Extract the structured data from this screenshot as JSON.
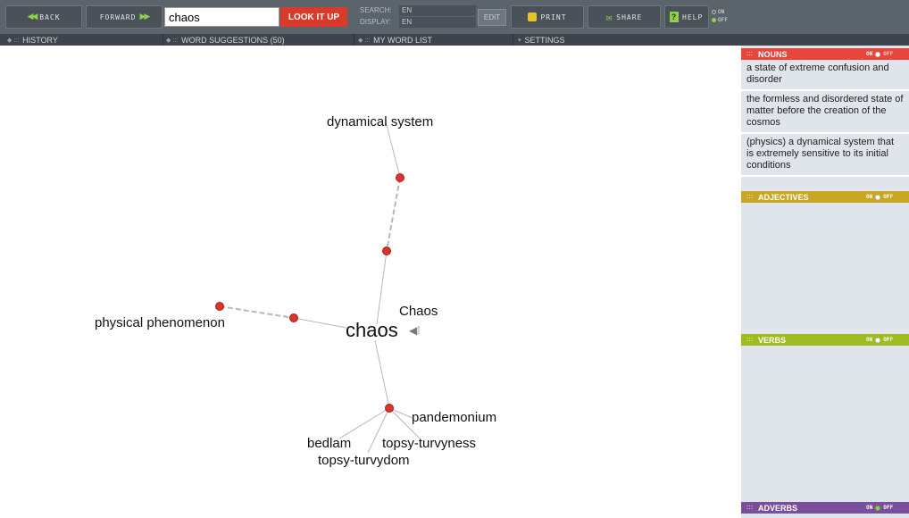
{
  "toolbar": {
    "back_label": "BACK",
    "forward_label": "FORWARD",
    "search_value": "chaos",
    "lookup_label": "LOOK IT UP",
    "search_lang_label": "SEARCH:",
    "search_lang_value": "EN",
    "display_lang_label": "DISPLAY:",
    "display_lang_value": "EN",
    "edit_label": "EDIT",
    "print_label": "PRINT",
    "share_label": "SHARE",
    "help_label": "HELP",
    "help_on_label": "ON",
    "help_off_label": "OFF"
  },
  "subbar": {
    "history_label": "HISTORY",
    "suggestions_label": "WORD SUGGESTIONS (50)",
    "wordlist_label": "MY WORD LIST",
    "settings_label": "SETTINGS"
  },
  "graph": {
    "center_word": "chaos",
    "words": {
      "dynamical_system": "dynamical system",
      "physical_phenomenon": "physical phenomenon",
      "chaos_capital": "Chaos",
      "pandemonium": "pandemonium",
      "bedlam": "bedlam",
      "topsy_turvyness": "topsy-turvyness",
      "topsy_turvydom": "topsy-turvydom"
    }
  },
  "panel": {
    "nouns": {
      "title": "NOUNS",
      "on_label": "ON",
      "off_label": "OFF",
      "definitions": [
        "a state of extreme confusion and disorder",
        "the formless and disordered state of matter before the creation of the cosmos",
        "(physics) a dynamical system that is extremely sensitive to its initial conditions"
      ]
    },
    "adjectives": {
      "title": "ADJECTIVES",
      "on_label": "ON",
      "off_label": "OFF"
    },
    "verbs": {
      "title": "VERBS",
      "on_label": "ON",
      "off_label": "OFF"
    },
    "adverbs": {
      "title": "ADVERBS",
      "on_label": "ON",
      "off_label": "OFF"
    }
  },
  "colors": {
    "nouns": "#e8453c",
    "adjectives": "#c9a722",
    "verbs": "#9fbb1f",
    "adverbs": "#7a4f9a",
    "node": "#d9342b",
    "accent_green": "#8fd14a"
  }
}
